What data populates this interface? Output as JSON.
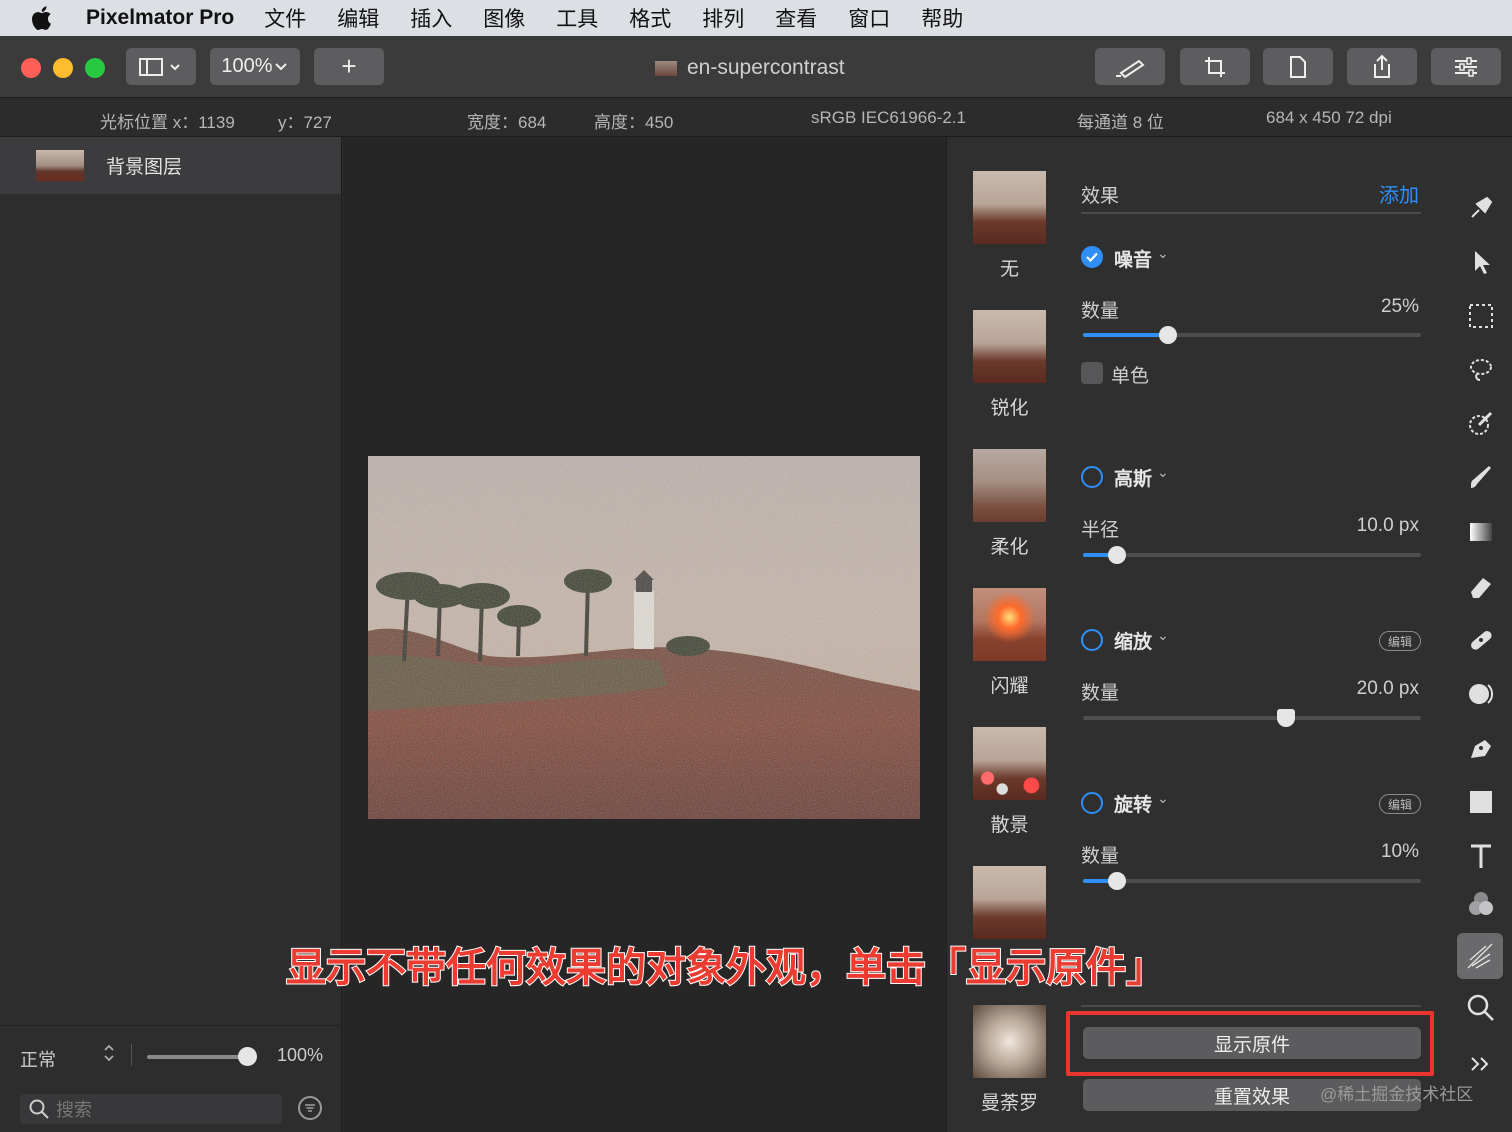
{
  "menubar": {
    "app_name": "Pixelmator Pro",
    "items": [
      "文件",
      "编辑",
      "插入",
      "图像",
      "工具",
      "格式",
      "排列",
      "查看",
      "窗口",
      "帮助"
    ]
  },
  "toolbar": {
    "zoom": "100%",
    "add_label": "+",
    "title": "en-supercontrast"
  },
  "infobar": {
    "cursor_x": "光标位置 x：1139",
    "cursor_y": "y：727",
    "width": "宽度：684",
    "height": "高度：450",
    "colorspace": "sRGB IEC61966-2.1",
    "bitdepth": "每通道 8 位",
    "dimensions": "684 x 450 72 dpi"
  },
  "layers": {
    "layer_name": "背景图层",
    "blend_mode": "正常",
    "opacity": "100%",
    "search_placeholder": "搜索"
  },
  "effects": {
    "header": "效果",
    "add": "添加",
    "presets": [
      "无",
      "锐化",
      "柔化",
      "闪耀",
      "散景",
      "",
      "曼荼罗"
    ],
    "noise": {
      "name": "噪音",
      "param": "数量",
      "value": "25%",
      "level": 0.25,
      "mono": "单色"
    },
    "gaussian": {
      "name": "高斯",
      "param": "半径",
      "value": "10.0 px",
      "level": 0.1
    },
    "zoom": {
      "name": "缩放",
      "badge": "编辑",
      "param": "数量",
      "value": "20.0 px",
      "level": 0.6
    },
    "spin": {
      "name": "旋转",
      "badge": "编辑",
      "param": "数量",
      "value": "10%",
      "level": 0.1
    },
    "show_original": "显示原件",
    "reset": "重置效果"
  },
  "annotation": "显示不带任何效果的对象外观，单击「显示原件」",
  "watermark": "@稀土掘金技术社区",
  "colors": {
    "accent": "#2f8ef7",
    "annotation_red": "#ec3b30"
  }
}
